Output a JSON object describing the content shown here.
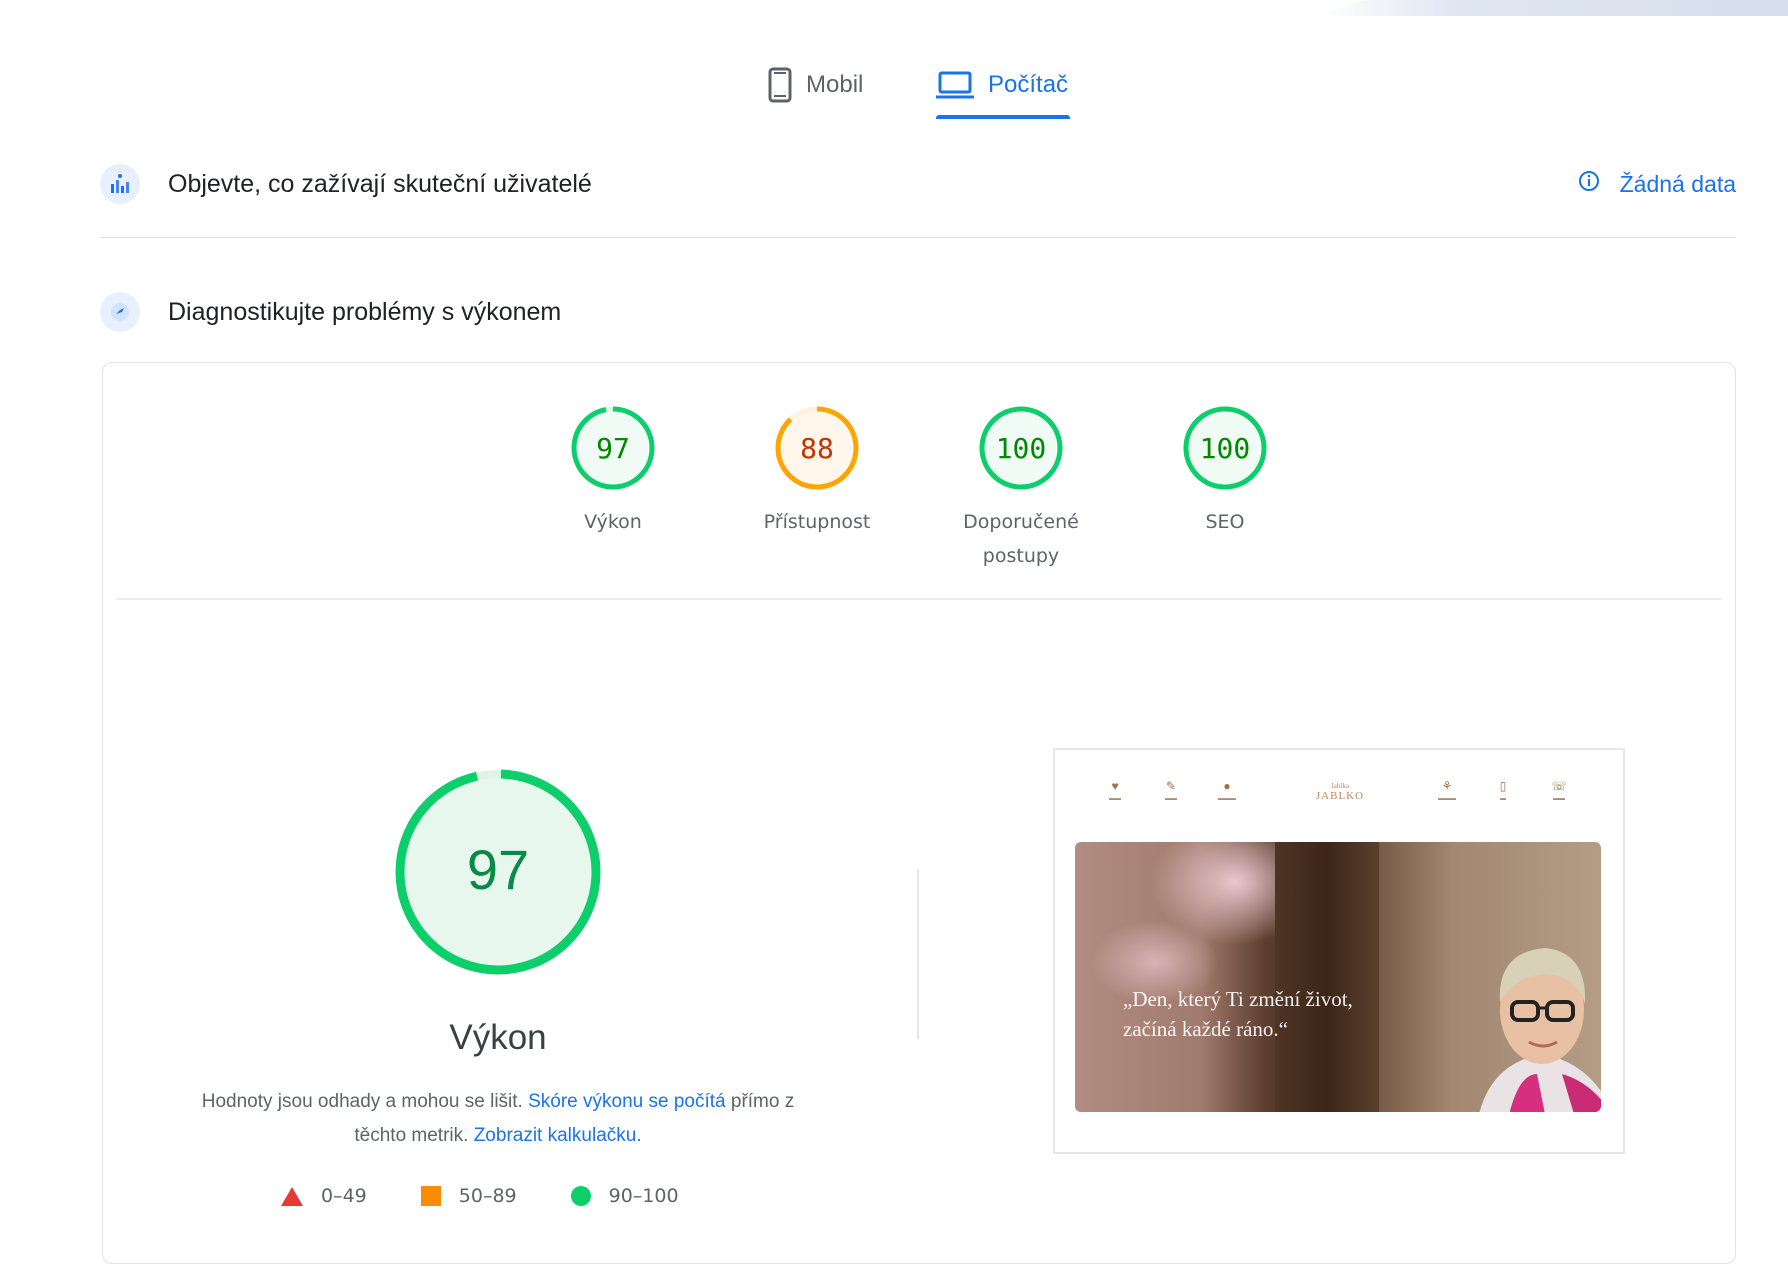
{
  "tabs": [
    {
      "label": "Mobil",
      "icon": "phone-icon",
      "active": false
    },
    {
      "label": "Počítač",
      "icon": "laptop-icon",
      "active": true
    }
  ],
  "field_data": {
    "title": "Objevte, co zažívají skuteční uživatelé",
    "status": "Žádná data",
    "status_icon": "info-icon"
  },
  "diagnostics": {
    "title": "Diagnostikujte problémy s výkonem"
  },
  "scores": [
    {
      "value": "97",
      "score": 97,
      "label_line1": "Výkon",
      "label_line2": "",
      "color": "#0cce6b"
    },
    {
      "value": "88",
      "score": 88,
      "label_line1": "Přístupnost",
      "label_line2": "",
      "color": "#ffa400"
    },
    {
      "value": "100",
      "score": 100,
      "label_line1": "Doporučené",
      "label_line2": "postupy",
      "color": "#0cce6b"
    },
    {
      "value": "100",
      "score": 100,
      "label_line1": "SEO",
      "label_line2": "",
      "color": "#0cce6b"
    }
  ],
  "performance": {
    "score": "97",
    "label": "Výkon",
    "desc_part1": "Hodnoty jsou odhady a mohou se lišit. ",
    "desc_link1": "Skóre výkonu se počítá",
    "desc_part2": " přímo z těchto metrik. ",
    "desc_link2": "Zobrazit kalkulačku."
  },
  "legend": [
    {
      "range": "0–49",
      "color": "#e53935"
    },
    {
      "range": "50–89",
      "color": "#fb8c00"
    },
    {
      "range": "90–100",
      "color": "#0cce6b"
    }
  ],
  "preview": {
    "logo_small": "Jablka",
    "logo_big": "JABLKO",
    "quote_line1": "„Den, který Ti změní život,",
    "quote_line2": "začíná každé ráno.“"
  },
  "colors": {
    "accent": "#1a73e8",
    "pass": "#0cce6b",
    "average": "#ffa400",
    "fail": "#e53935"
  }
}
